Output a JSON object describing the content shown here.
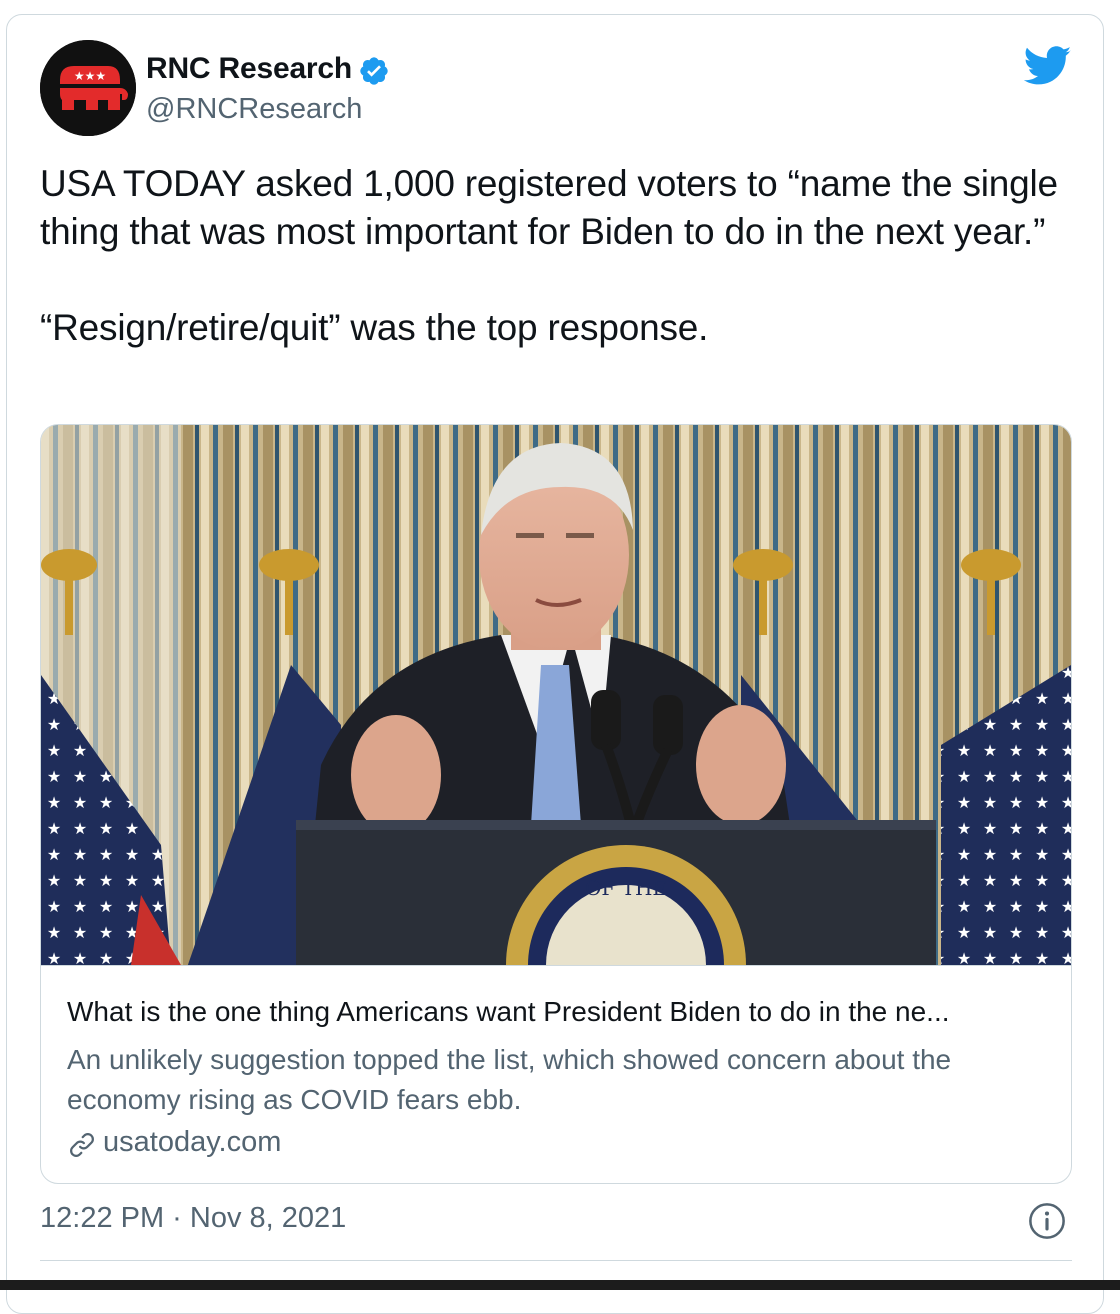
{
  "tweet": {
    "author": {
      "display_name": "RNC Research",
      "handle": "@RNCResearch",
      "verified": true,
      "avatar_icon": "republican-elephant-logo",
      "avatar_colors": {
        "background": "#111111",
        "elephant": "#e32b2b",
        "stars": "#ffffff"
      }
    },
    "text": {
      "paragraph_1": "USA TODAY asked 1,000 registered voters to “name the single thing that was most important for Biden to do in the next year.”",
      "paragraph_2": "“Resign/retire/quit” was the top response."
    },
    "link_card": {
      "image_description_icon": "photo-president-at-podium",
      "title": "What is the one thing Americans want President Biden to do in the ne...",
      "description": "An unlikely suggestion topped the list, which showed concern about the economy rising as COVID fears ebb.",
      "domain": "usatoday.com",
      "link_icon": "link-icon"
    },
    "timestamp": "12:22 PM · Nov 8, 2021",
    "info_icon": "info-icon"
  },
  "colors": {
    "twitter_blue": "#1d9bf0",
    "text_primary": "#0f1419",
    "text_secondary": "#536471",
    "border": "#cfd9de"
  }
}
